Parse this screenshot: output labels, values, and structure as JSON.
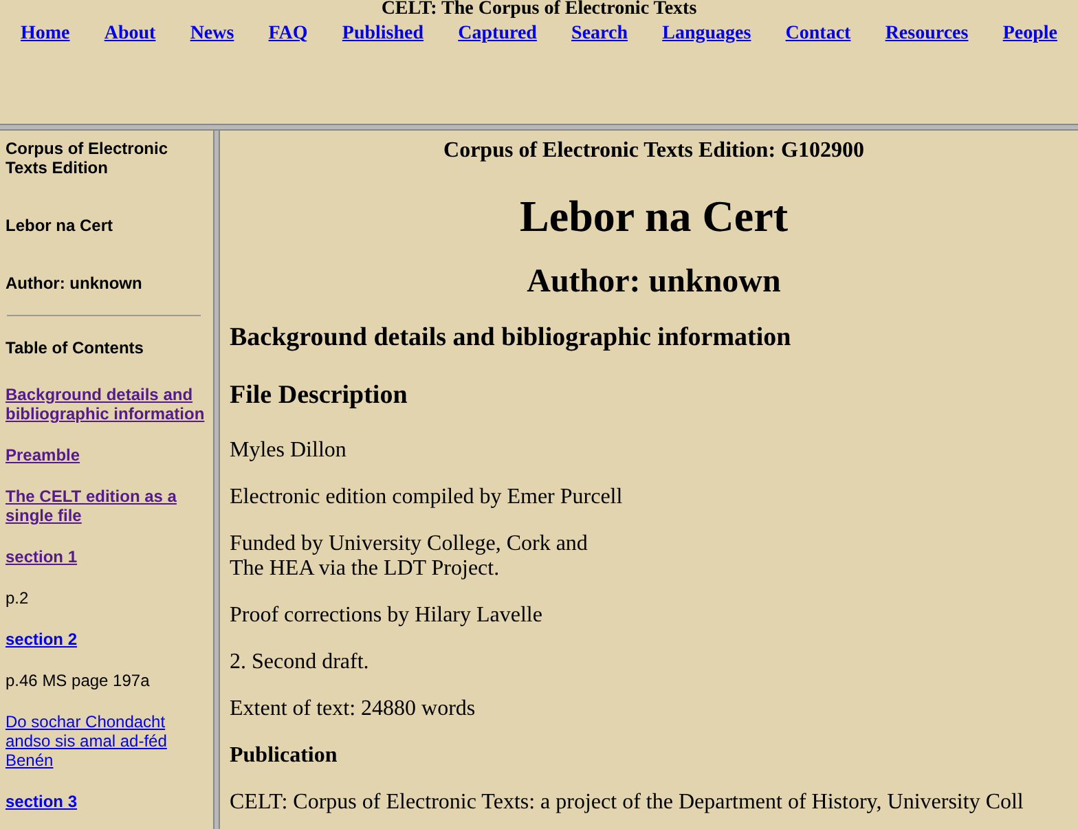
{
  "header": {
    "title": "CELT: The Corpus of Electronic Texts",
    "nav": [
      "Home",
      "About",
      "News",
      "FAQ",
      "Published",
      "Captured",
      "Search",
      "Languages",
      "Contact",
      "Resources",
      "People"
    ]
  },
  "sidebar": {
    "items": [
      {
        "kind": "heading",
        "text": "Corpus of Electronic Texts Edition"
      },
      {
        "kind": "heading",
        "text": "Lebor na Cert"
      },
      {
        "kind": "heading",
        "text": "Author: unknown"
      },
      {
        "kind": "rule"
      },
      {
        "kind": "heading",
        "text": "Table of Contents"
      },
      {
        "kind": "link",
        "text": "Background details and bibliographic information",
        "bold": true,
        "visited": true
      },
      {
        "kind": "link",
        "text": "Preamble",
        "bold": true,
        "visited": true
      },
      {
        "kind": "link",
        "text": "The CELT edition as a single file",
        "bold": true,
        "visited": true
      },
      {
        "kind": "link",
        "text": "section 1",
        "bold": true,
        "visited": true
      },
      {
        "kind": "text",
        "text": "p.2"
      },
      {
        "kind": "link",
        "text": "section 2",
        "bold": true,
        "visited": false
      },
      {
        "kind": "text",
        "text": "p.46 MS page 197a"
      },
      {
        "kind": "link",
        "text": "Do sochar Chondacht andso sis amal ad-féd Benén",
        "bold": false,
        "visited": false
      },
      {
        "kind": "link",
        "text": "section 3",
        "bold": true,
        "visited": false
      }
    ]
  },
  "main": {
    "blocks": [
      {
        "kind": "edition",
        "text": "Corpus of Electronic Texts Edition: G102900"
      },
      {
        "kind": "title",
        "text": "Lebor na Cert"
      },
      {
        "kind": "author",
        "text": "Author: unknown"
      },
      {
        "kind": "h3",
        "text": "Background details and bibliographic information"
      },
      {
        "kind": "h3",
        "text": "File Description"
      },
      {
        "kind": "p",
        "lines": [
          "Myles Dillon"
        ]
      },
      {
        "kind": "p",
        "lines": [
          "Electronic edition compiled by Emer Purcell"
        ]
      },
      {
        "kind": "p",
        "lines": [
          "Funded by University College, Cork and",
          "The HEA via the LDT Project."
        ]
      },
      {
        "kind": "p",
        "lines": [
          "Proof corrections by Hilary Lavelle"
        ]
      },
      {
        "kind": "p",
        "lines": [
          "2. Second draft."
        ]
      },
      {
        "kind": "p",
        "lines": [
          "Extent of text: 24880 words"
        ]
      },
      {
        "kind": "h4",
        "text": "Publication"
      },
      {
        "kind": "p",
        "lines": [
          "CELT: Corpus of Electronic Texts: a project of the Department of History, University Coll"
        ]
      }
    ]
  }
}
